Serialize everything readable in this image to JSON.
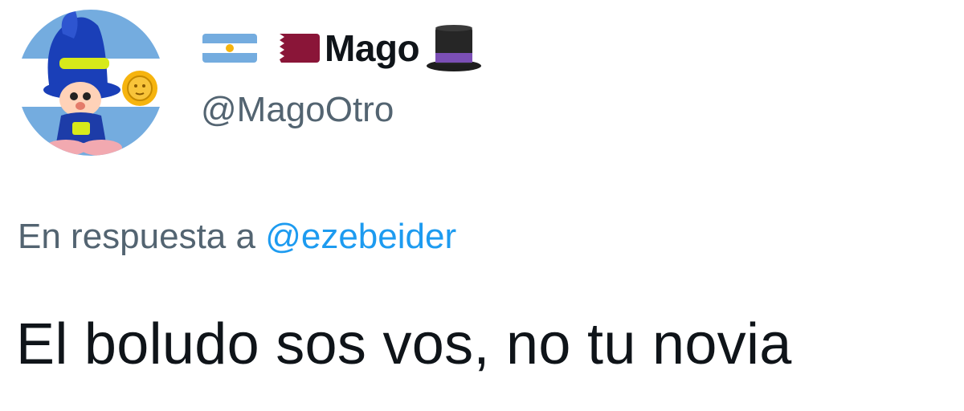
{
  "user": {
    "display_name": "Mago",
    "handle": "@MagoOtro",
    "name_emojis": [
      "flag-argentina-icon",
      "flag-qatar-icon",
      "top-hat-icon"
    ],
    "avatar": "cartoon-boy-blue-hat-argentina-flag-avatar"
  },
  "reply": {
    "prefix": "En respuesta a",
    "mention": "@ezebeider"
  },
  "tweet": {
    "text": "El boludo sos vos, no tu novia"
  },
  "colors": {
    "text_primary": "#0f1419",
    "text_secondary": "#536471",
    "link": "#1d9bf0",
    "argentina_blue": "#74acdf",
    "qatar_maroon": "#8a1538"
  }
}
